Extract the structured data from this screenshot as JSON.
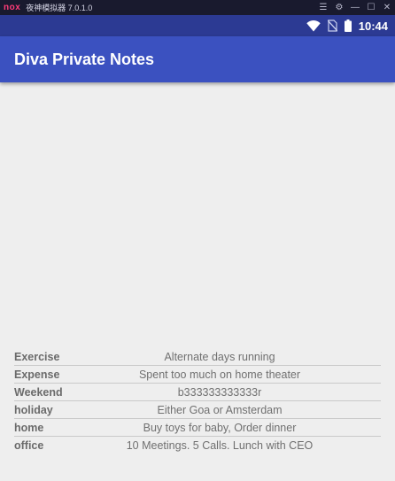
{
  "emulator": {
    "logo": "nox",
    "title": "夜神模拟器 7.0.1.0"
  },
  "status_bar": {
    "time": "10:44"
  },
  "app_bar": {
    "title": "Diva Private Notes"
  },
  "notes": [
    {
      "title": "Exercise",
      "note": "Alternate days running"
    },
    {
      "title": "Expense",
      "note": "Spent too much on home theater"
    },
    {
      "title": "Weekend",
      "note": "b333333333333r"
    },
    {
      "title": "holiday",
      "note": "Either Goa or Amsterdam"
    },
    {
      "title": "home",
      "note": "Buy toys for baby, Order dinner"
    },
    {
      "title": "office",
      "note": "10 Meetings. 5 Calls. Lunch with CEO"
    }
  ]
}
